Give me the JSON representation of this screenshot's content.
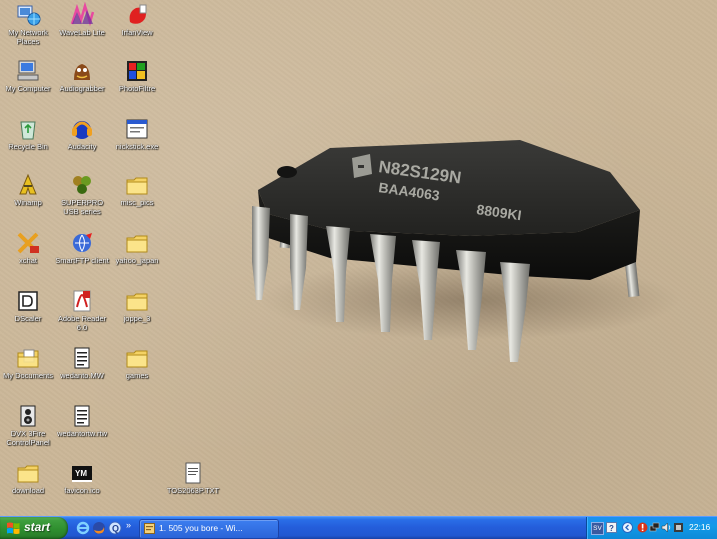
{
  "desktop": {
    "icons": [
      {
        "id": "my-network-places",
        "label": "My Network Places",
        "icon": "network-places-icon"
      },
      {
        "id": "wavelab-lite",
        "label": "WaveLab Lite",
        "icon": "wavelab-icon"
      },
      {
        "id": "irfanview",
        "label": "IrfanView",
        "icon": "irfanview-icon"
      },
      {
        "id": "my-computer",
        "label": "My Computer",
        "icon": "my-computer-icon"
      },
      {
        "id": "audiograbber",
        "label": "Audiograbber",
        "icon": "audiograbber-icon"
      },
      {
        "id": "photofiltre",
        "label": "PhotoFiltre",
        "icon": "photofiltre-icon"
      },
      {
        "id": "recycle-bin",
        "label": "Recycle Bin",
        "icon": "recycle-bin-icon"
      },
      {
        "id": "audacity",
        "label": "Audacity",
        "icon": "audacity-icon"
      },
      {
        "id": "nick-exe",
        "label": "nickstick.exe",
        "icon": "window-app-icon"
      },
      {
        "id": "winamp",
        "label": "Winamp",
        "icon": "winamp-icon"
      },
      {
        "id": "superpro",
        "label": "SUPERPRO USB series",
        "icon": "superpro-icon"
      },
      {
        "id": "misc-pics",
        "label": "misc_pics",
        "icon": "folder-icon"
      },
      {
        "id": "xchat",
        "label": "xchat",
        "icon": "xchat-icon"
      },
      {
        "id": "smartftp",
        "label": "SmartFTP client",
        "icon": "smartftp-icon"
      },
      {
        "id": "yahoo-japan",
        "label": "yahoo_japan",
        "icon": "folder-icon"
      },
      {
        "id": "dscaler",
        "label": "DScaler",
        "icon": "dscaler-icon"
      },
      {
        "id": "adobe-reader",
        "label": "Adobe Reader 6.0",
        "icon": "adobe-reader-icon"
      },
      {
        "id": "joppe-3",
        "label": "joppe_3",
        "icon": "folder-icon"
      },
      {
        "id": "my-documents",
        "label": "My Documents",
        "icon": "my-documents-icon"
      },
      {
        "id": "wedanto-mw",
        "label": "wedanto.MW",
        "icon": "document-icon"
      },
      {
        "id": "games",
        "label": "games",
        "icon": "folder-icon"
      },
      {
        "id": "dvx-control",
        "label": "DVX 3Fire ControlPanel",
        "icon": "speaker-icon"
      },
      {
        "id": "wedanto-rtw",
        "label": "wedantortw.rtw",
        "icon": "document-icon"
      },
      {
        "id": "download",
        "label": "download",
        "icon": "folder-icon"
      },
      {
        "id": "favicon",
        "label": "favicon.ico",
        "icon": "favicon-icon"
      },
      {
        "id": "tos-txt",
        "label": "TOS2063P.TXT",
        "icon": "text-file-icon"
      }
    ]
  },
  "photo": {
    "chip_marking_line1": "N82S129N",
    "chip_marking_line2": "BAA4063",
    "chip_marking_line3": "8809KI"
  },
  "taskbar": {
    "start_label": "start",
    "quicklaunch_more": "»",
    "task_label": "1. 505 you bore - Wi...",
    "language": "SV",
    "clock": "22:16"
  },
  "colors": {
    "desktop_bg": "#cbb798",
    "taskbar": "#245edb",
    "start_green": "#3e9e3e",
    "tray": "#129ae8"
  }
}
